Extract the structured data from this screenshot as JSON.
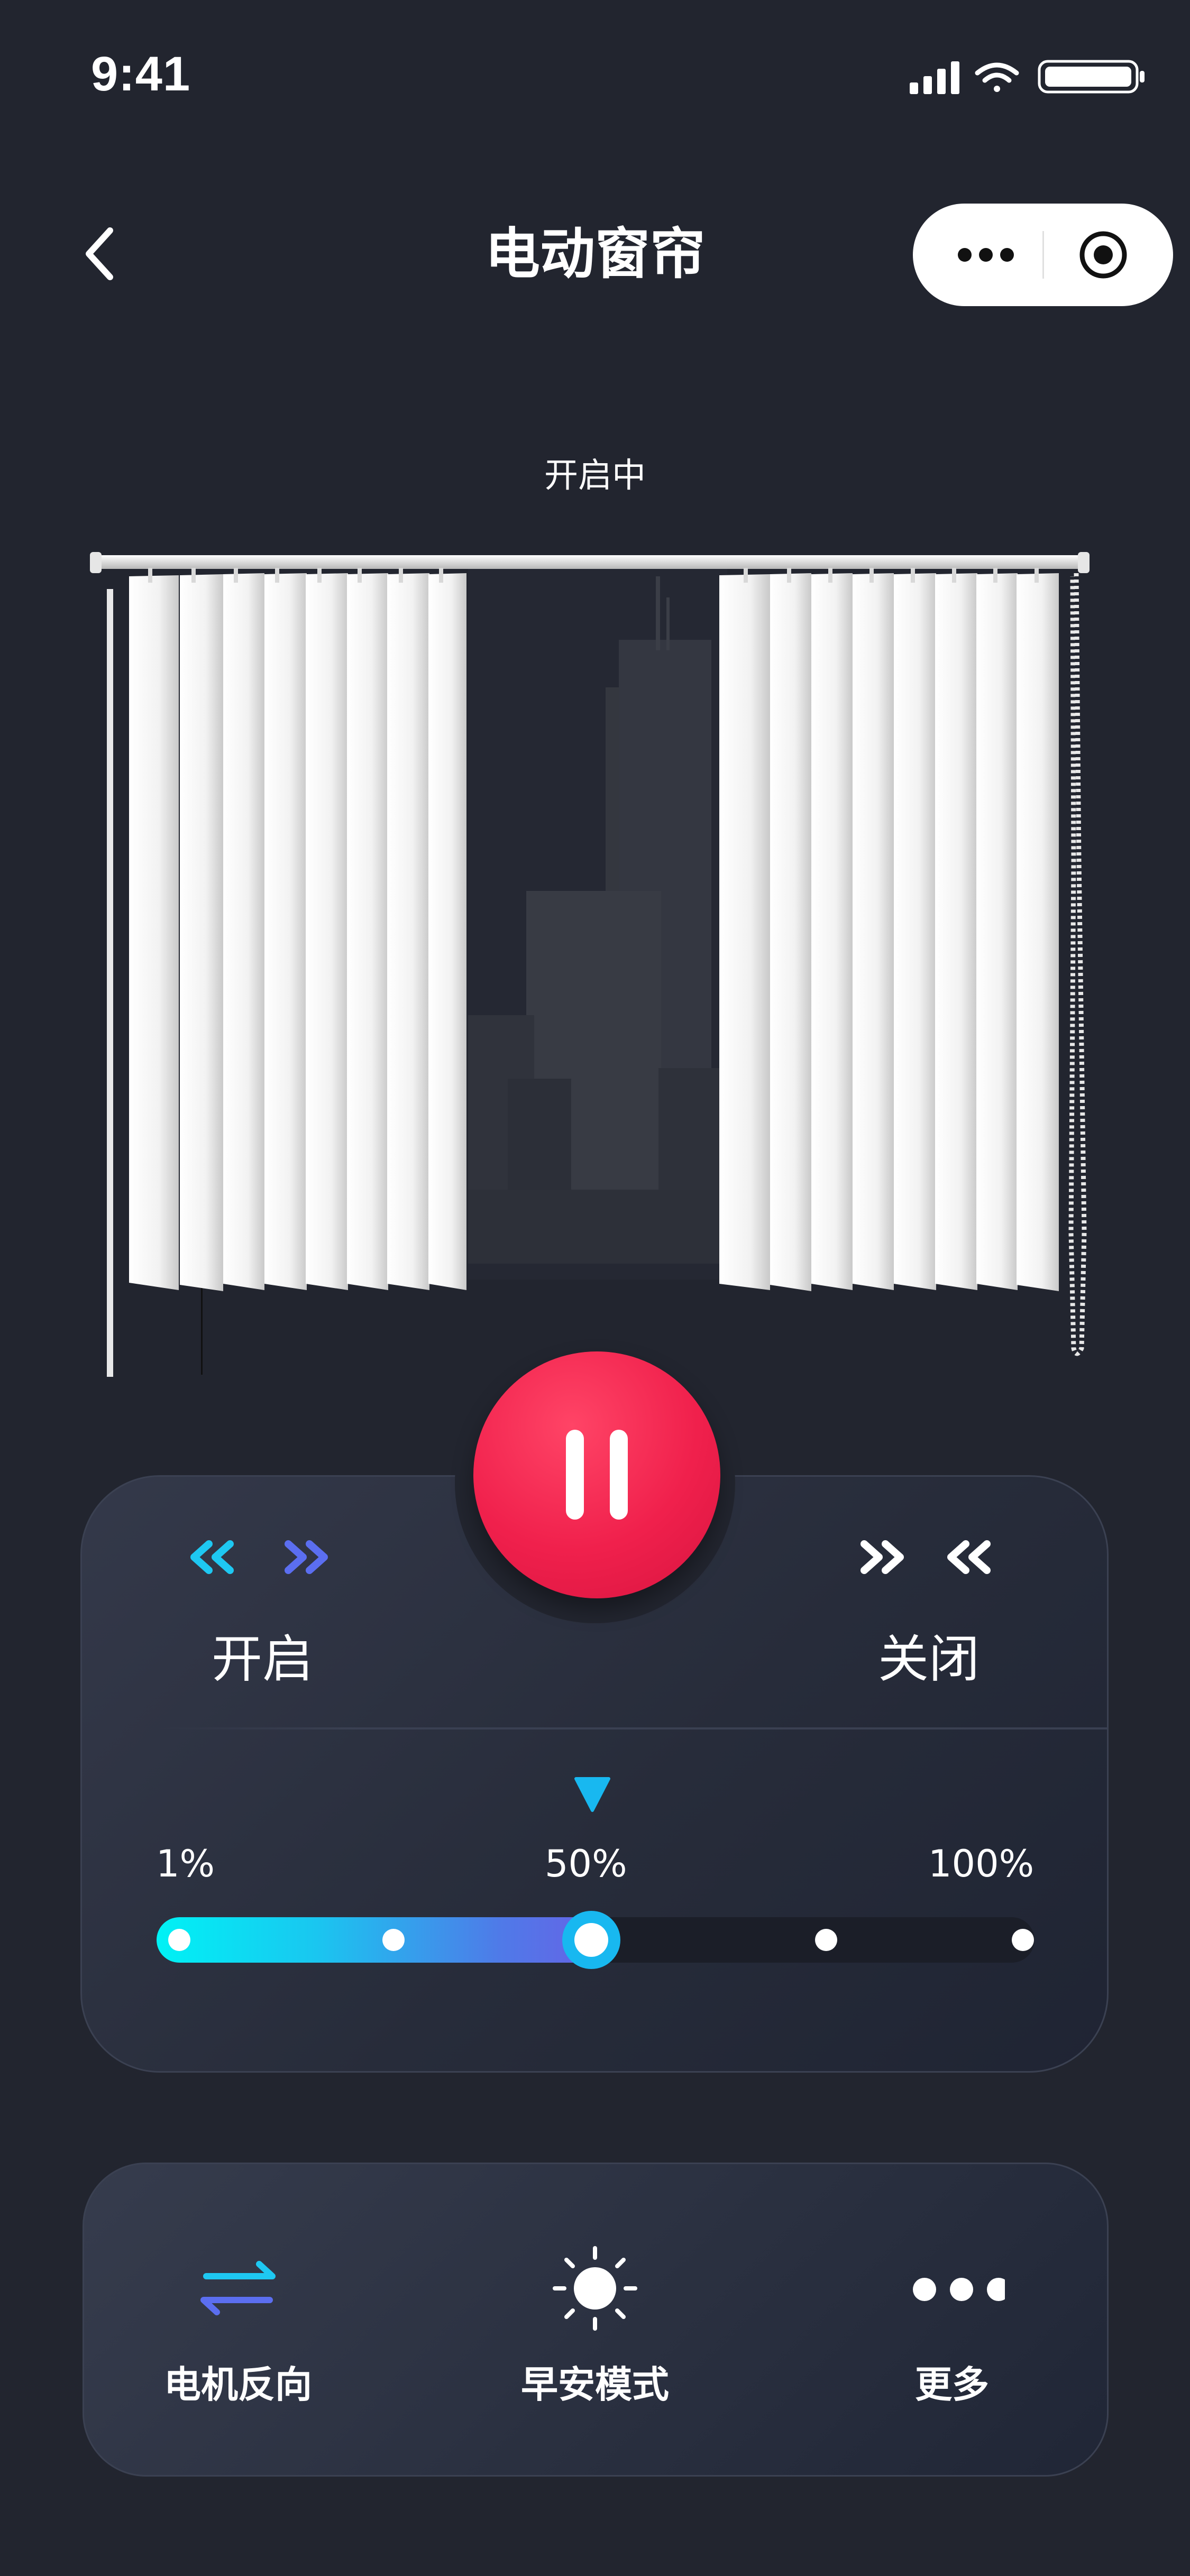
{
  "status_bar": {
    "time": "9:41"
  },
  "nav": {
    "title": "电动窗帘"
  },
  "curtain": {
    "state_text": "开启中"
  },
  "controls": {
    "open_label": "开启",
    "close_label": "关闭",
    "open_arrows": "<< >>",
    "close_arrows": ">> <<"
  },
  "progress": {
    "label_min": "1%",
    "label_mid": "50%",
    "label_max": "100%",
    "value_percent": 50
  },
  "functions": [
    {
      "label": "电机反向",
      "icon": "reverse-arrows-icon"
    },
    {
      "label": "早安模式",
      "icon": "sun-icon"
    },
    {
      "label": "更多",
      "icon": "more-dots-icon"
    }
  ],
  "colors": {
    "background": "#22252f",
    "accent_start": "#00f2f5",
    "accent_end": "#6a5fe6",
    "pause_button": "#f0204c"
  }
}
